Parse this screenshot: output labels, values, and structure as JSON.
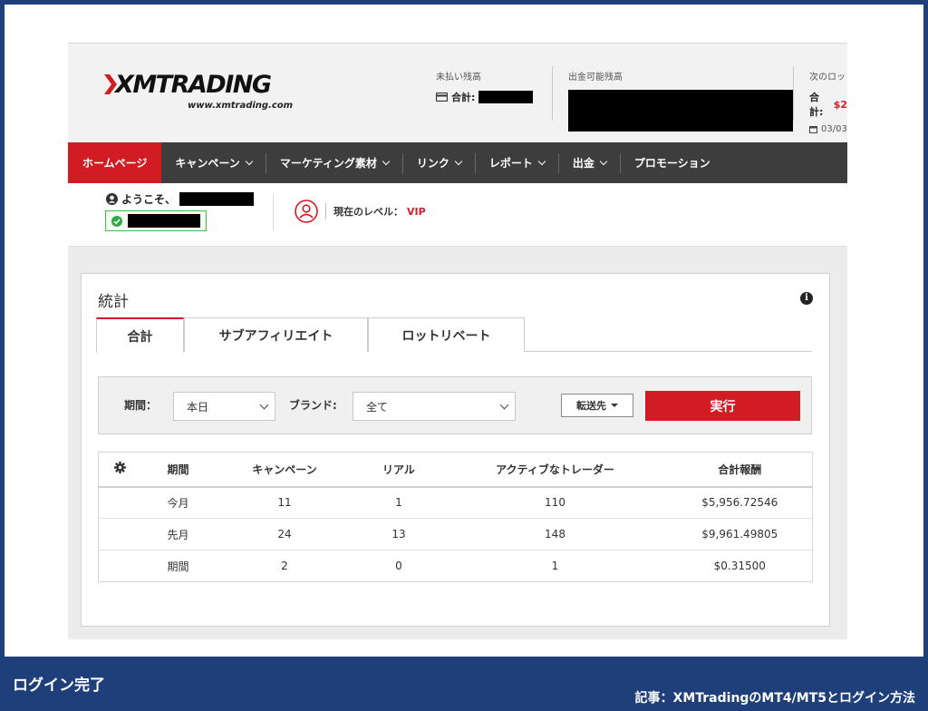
{
  "brand": {
    "logo_text": "XMTRADING",
    "logo_url": "www.xmtrading.com"
  },
  "header": {
    "unpaid_label": "未払い残高",
    "total_label": "合計:",
    "withdrawable_label": "出金可能残高",
    "next_label": "次のロッ",
    "next_total_label": "合計:",
    "next_total_value": "$2",
    "next_date": "03/03"
  },
  "nav": {
    "items": [
      {
        "label": "ホームページ"
      },
      {
        "label": "キャンペーン"
      },
      {
        "label": "マーケティング素材"
      },
      {
        "label": "リンク"
      },
      {
        "label": "レポート"
      },
      {
        "label": "出金"
      },
      {
        "label": "プロモーション"
      }
    ]
  },
  "welcome": {
    "greeting": "ようこそ、",
    "level_label": "現在のレベル：",
    "level_value": "VIP"
  },
  "stats": {
    "title": "統計",
    "info_icon": "i",
    "tabs": [
      {
        "label": "合計"
      },
      {
        "label": "サブアフィリエイト"
      },
      {
        "label": "ロットリベート"
      }
    ],
    "filter": {
      "period_label": "期間：",
      "period_value": "本日",
      "brand_label": "ブランド:",
      "brand_value": "全て",
      "transfer_label": "転送先",
      "execute_label": "実行"
    },
    "table": {
      "headers": [
        "期間",
        "キャンペーン",
        "リアル",
        "アクティブなトレーダー",
        "合計報酬"
      ],
      "rows": [
        [
          "今月",
          "11",
          "1",
          "110",
          "$5,956.72546"
        ],
        [
          "先月",
          "24",
          "13",
          "148",
          "$9,961.49805"
        ],
        [
          "期間",
          "2",
          "0",
          "1",
          "$0.31500"
        ]
      ]
    }
  },
  "caption": {
    "left": "ログイン完了",
    "right": "記事：XMTradingのMT4/MT5とログイン方法"
  },
  "colors": {
    "accent_red": "#d21c24",
    "nav_bg": "#3d3d3d",
    "frame_blue": "#1f3f7a"
  }
}
